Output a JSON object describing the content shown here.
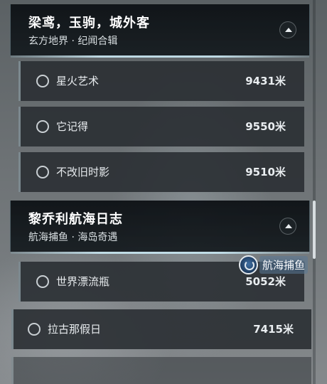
{
  "categories": [
    {
      "title": "梁鸢，玉驹，城外客",
      "subtitle": "玄方地界 · 纪闻合辑",
      "items": [
        {
          "label": "星火艺术",
          "distance": "9431米"
        },
        {
          "label": "它记得",
          "distance": "9550米"
        },
        {
          "label": "不改旧时影",
          "distance": "9510米"
        }
      ]
    },
    {
      "title": "黎乔利航海日志",
      "subtitle": "航海捕鱼 · 海岛奇遇",
      "items": [
        {
          "label": "世界漂流瓶",
          "distance": "5052米"
        }
      ]
    }
  ],
  "standalone_items": [
    {
      "label": "拉古那假日",
      "distance": "7415米"
    }
  ],
  "badge": {
    "label": "航海捕鱼",
    "icon": "compass-icon"
  },
  "icons": {
    "collapse": "chevron-up-icon",
    "radio": "radio-circle-icon"
  }
}
